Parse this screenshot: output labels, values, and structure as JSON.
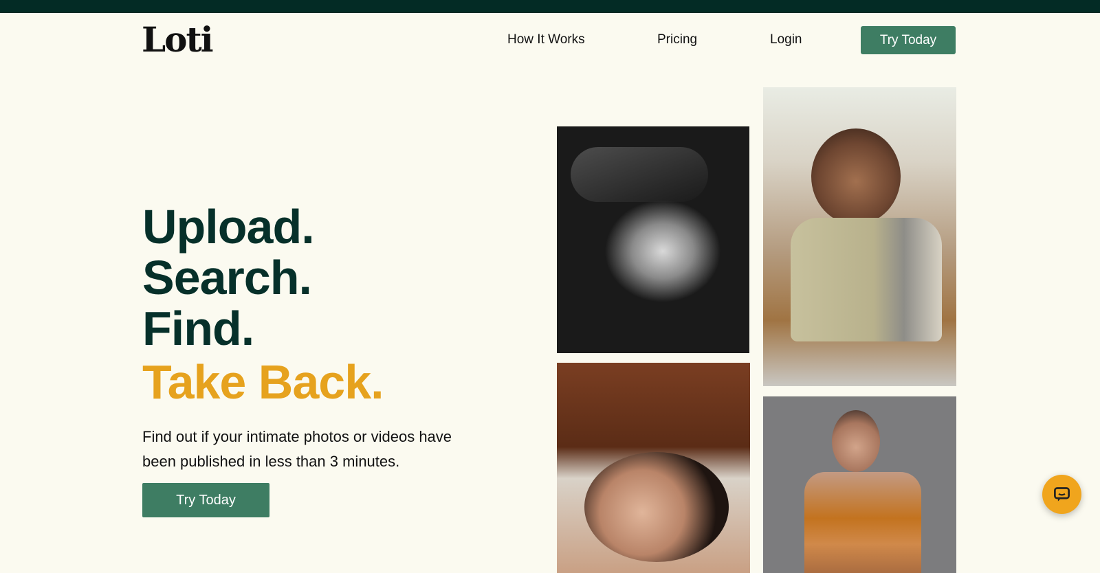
{
  "header": {
    "logo": "Loti",
    "nav": {
      "how_it_works": "How It Works",
      "pricing": "Pricing",
      "login": "Login"
    },
    "cta": "Try Today"
  },
  "hero": {
    "lines": [
      "Upload.",
      "Search.",
      "Find.",
      "Take Back."
    ],
    "subtext": "Find out if your intimate photos or videos have been published in less than 3 minutes.",
    "cta": "Try Today"
  },
  "colors": {
    "dark_green": "#06302a",
    "accent_orange": "#e6a21e",
    "button_green": "#3e7d63",
    "background": "#fbfaf0"
  },
  "icons": {
    "chat": "chat-icon"
  }
}
